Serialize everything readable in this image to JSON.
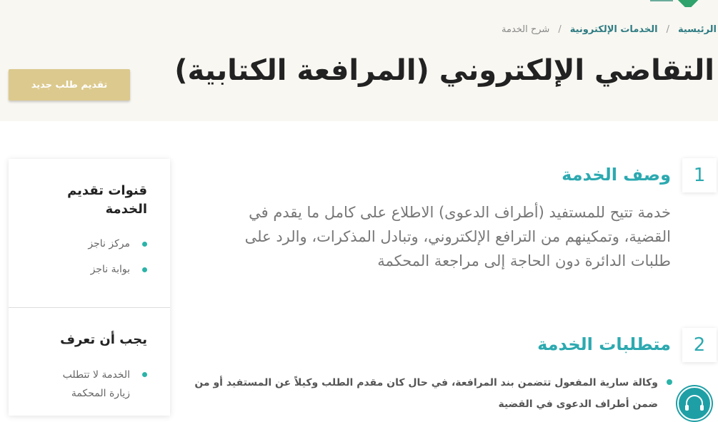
{
  "breadcrumb": {
    "home": "الرئيسية",
    "eservices": "الخدمات الإلكترونية",
    "current": "شرح الخدمة",
    "separator": "/"
  },
  "page": {
    "title": "التقاضي الإلكتروني (المرافعة الكتابية)"
  },
  "actions": {
    "new_request": "تقديم طلب جديد"
  },
  "sections": [
    {
      "number": "1",
      "title": "وصف الخدمة",
      "description": "خدمة تتيح للمستفيد (أطراف الدعوى) الاطلاع على كامل ما يقدم في القضية، وتمكينهم من الترافع الإلكتروني، وتبادل المذكرات، والرد على طلبات الدائرة دون الحاجة إلى مراجعة المحكمة"
    },
    {
      "number": "2",
      "title": "متطلبات الخدمة",
      "items": [
        "وكالة سارية المفعول تتضمن بند المرافعة، في حال كان مقدم الطلب وكيلاً عن المستفيد أو من ضمن أطراف الدعوى في القضية"
      ]
    }
  ],
  "sidebar": {
    "channels_title": "قنوات تقديم الخدمة",
    "channels": [
      "مركز ناجز",
      "بوابة ناجز"
    ],
    "know_title": "يجب أن تعرف",
    "know_items": [
      "الخدمة لا تتطلب زيارة المحكمة"
    ]
  },
  "icons": {
    "help": "headset-icon",
    "logo": "logo-icon"
  },
  "colors": {
    "accent": "#2ca9b0",
    "button": "#dcc98d",
    "hero_bg": "#f8f7f2"
  }
}
